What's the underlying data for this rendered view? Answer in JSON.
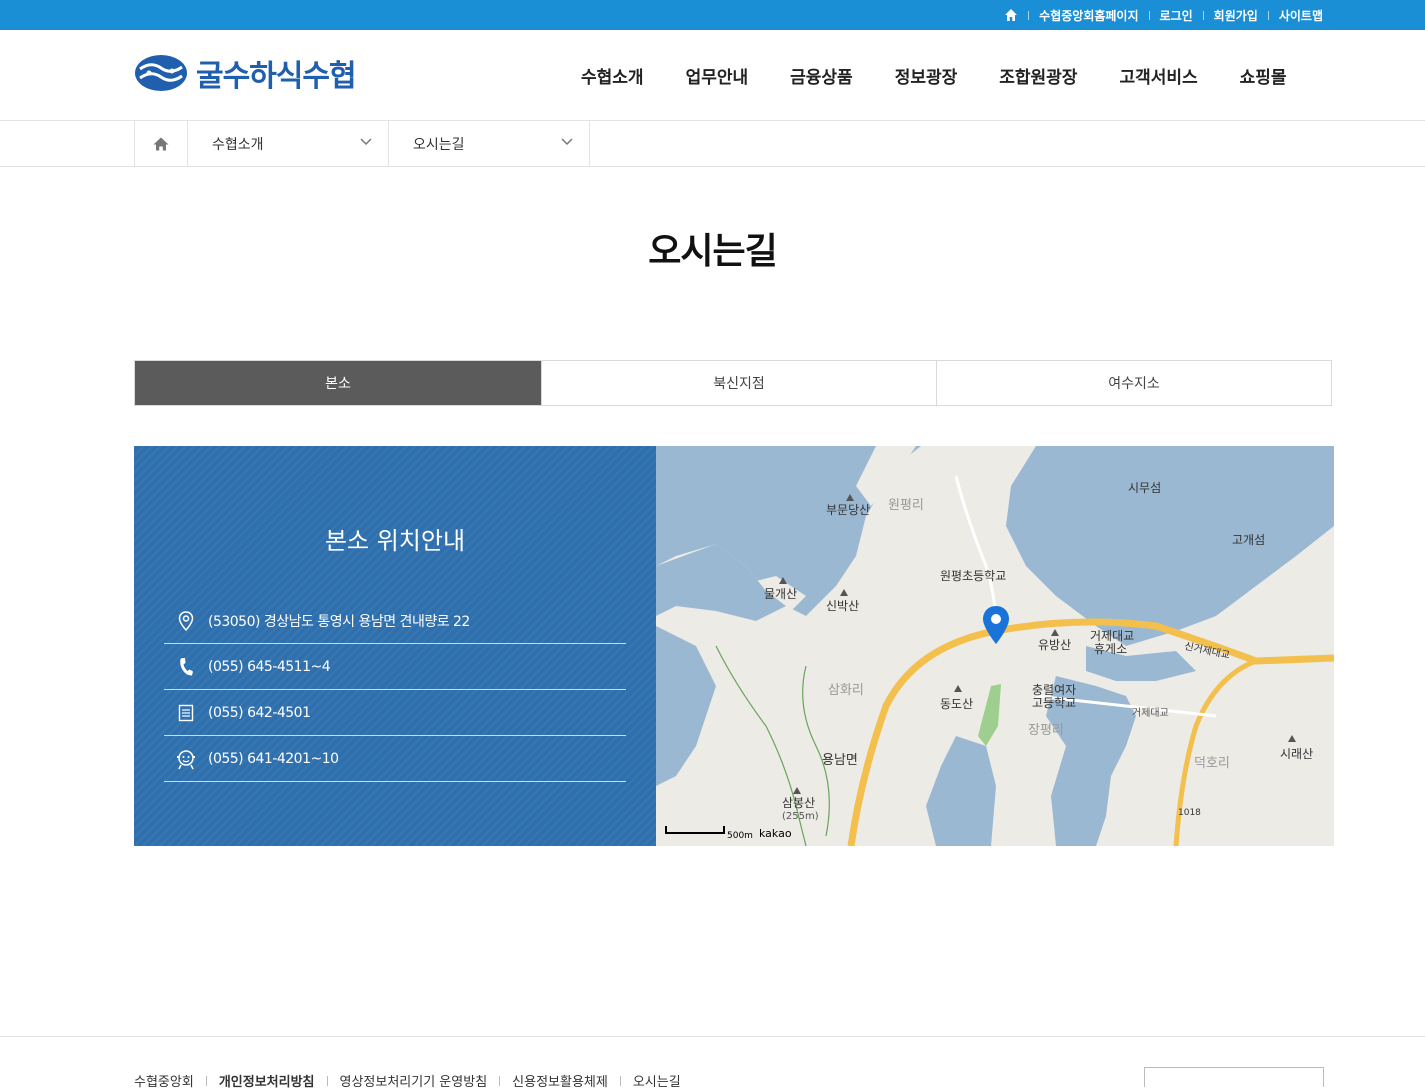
{
  "topbar": {
    "links": [
      "수협중앙회홈페이지",
      "로그인",
      "회원가입",
      "사이트맵"
    ],
    "home_icon": "home-icon"
  },
  "header": {
    "logo_text": "굴수하식수협",
    "nav": [
      "수협소개",
      "업무안내",
      "금융상품",
      "정보광장",
      "조합원광장",
      "고객서비스",
      "쇼핑몰"
    ]
  },
  "breadcrumb": {
    "home_icon": "home-icon",
    "level1": "수협소개",
    "level2": "오시는길"
  },
  "page": {
    "title": "오시는길"
  },
  "tabs": [
    {
      "label": "본소",
      "active": true
    },
    {
      "label": "북신지점",
      "active": false
    },
    {
      "label": "여수지소",
      "active": false
    }
  ],
  "location": {
    "title": "본소 위치안내",
    "items": [
      {
        "icon": "map-pin-icon",
        "text": "(53050) 경상남도 통영시 용남면 견내량로 22"
      },
      {
        "icon": "phone-icon",
        "text": "(055) 645-4511~4"
      },
      {
        "icon": "fax-icon",
        "text": "(055) 642-4501"
      },
      {
        "icon": "support-icon",
        "text": "(055) 641-4201~10"
      }
    ]
  },
  "map": {
    "labels": [
      "부문당산",
      "원평리",
      "시무섬",
      "고개섬",
      "원평초등학교",
      "물개산",
      "신박산",
      "유방산",
      "거제대교",
      "휴게소",
      "신거제대교",
      "삼화리",
      "동도산",
      "충렬여자",
      "고등학교",
      "거제대교",
      "장평리",
      "용남면",
      "덕호리",
      "시래산",
      "삼봉산",
      "(255m)",
      "1018"
    ],
    "scale": "500m",
    "brand": "kakao"
  },
  "footer": {
    "links": [
      "수협중앙회",
      "개인정보처리방침",
      "영상정보처리기기 운영방침",
      "신용정보활용체제",
      "오시는길"
    ]
  }
}
